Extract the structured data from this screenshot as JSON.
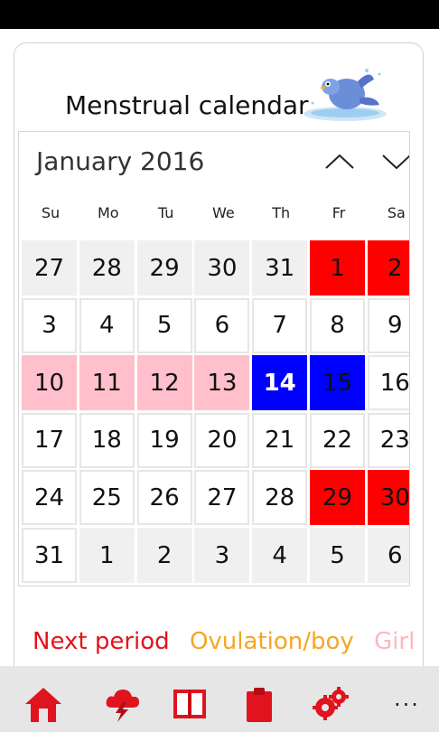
{
  "app": {
    "title": "Menstrual calendar"
  },
  "calendar": {
    "month_label": "January 2016",
    "weekdays": [
      "Su",
      "Mo",
      "Tu",
      "We",
      "Th",
      "Fr",
      "Sa"
    ],
    "weeks": [
      [
        {
          "d": "27",
          "t": "out"
        },
        {
          "d": "28",
          "t": "out"
        },
        {
          "d": "29",
          "t": "out"
        },
        {
          "d": "30",
          "t": "out"
        },
        {
          "d": "31",
          "t": "out"
        },
        {
          "d": "1",
          "t": "period"
        },
        {
          "d": "2",
          "t": "period"
        }
      ],
      [
        {
          "d": "3",
          "t": "in"
        },
        {
          "d": "4",
          "t": "in"
        },
        {
          "d": "5",
          "t": "in"
        },
        {
          "d": "6",
          "t": "in"
        },
        {
          "d": "7",
          "t": "in"
        },
        {
          "d": "8",
          "t": "in"
        },
        {
          "d": "9",
          "t": "in"
        }
      ],
      [
        {
          "d": "10",
          "t": "girl"
        },
        {
          "d": "11",
          "t": "girl"
        },
        {
          "d": "12",
          "t": "girl"
        },
        {
          "d": "13",
          "t": "girl"
        },
        {
          "d": "14",
          "t": "ovul",
          "today": true
        },
        {
          "d": "15",
          "t": "ovul"
        },
        {
          "d": "16",
          "t": "in"
        }
      ],
      [
        {
          "d": "17",
          "t": "in"
        },
        {
          "d": "18",
          "t": "in"
        },
        {
          "d": "19",
          "t": "in"
        },
        {
          "d": "20",
          "t": "in"
        },
        {
          "d": "21",
          "t": "in"
        },
        {
          "d": "22",
          "t": "in"
        },
        {
          "d": "23",
          "t": "in"
        }
      ],
      [
        {
          "d": "24",
          "t": "in"
        },
        {
          "d": "25",
          "t": "in"
        },
        {
          "d": "26",
          "t": "in"
        },
        {
          "d": "27",
          "t": "in"
        },
        {
          "d": "28",
          "t": "in"
        },
        {
          "d": "29",
          "t": "period"
        },
        {
          "d": "30",
          "t": "period"
        }
      ],
      [
        {
          "d": "31",
          "t": "in"
        },
        {
          "d": "1",
          "t": "out"
        },
        {
          "d": "2",
          "t": "out"
        },
        {
          "d": "3",
          "t": "out"
        },
        {
          "d": "4",
          "t": "out"
        },
        {
          "d": "5",
          "t": "out"
        },
        {
          "d": "6",
          "t": "out"
        }
      ]
    ]
  },
  "legend": {
    "next_period": "Next period",
    "ovulation_boy": "Ovulation/boy",
    "girl": "Girl"
  },
  "colors": {
    "period": "#ff0000",
    "ovulation": "#0000ff",
    "girl": "#ffc0cb",
    "legend_period": "#e8111a",
    "legend_ovulation": "#f5a623",
    "legend_girl": "#ffb6c1",
    "icon_red": "#e0141e"
  },
  "appbar": {
    "buttons": [
      "home-icon",
      "cloud-lightning-icon",
      "book-icon",
      "clipboard-icon",
      "gears-icon"
    ],
    "more_label": "..."
  }
}
